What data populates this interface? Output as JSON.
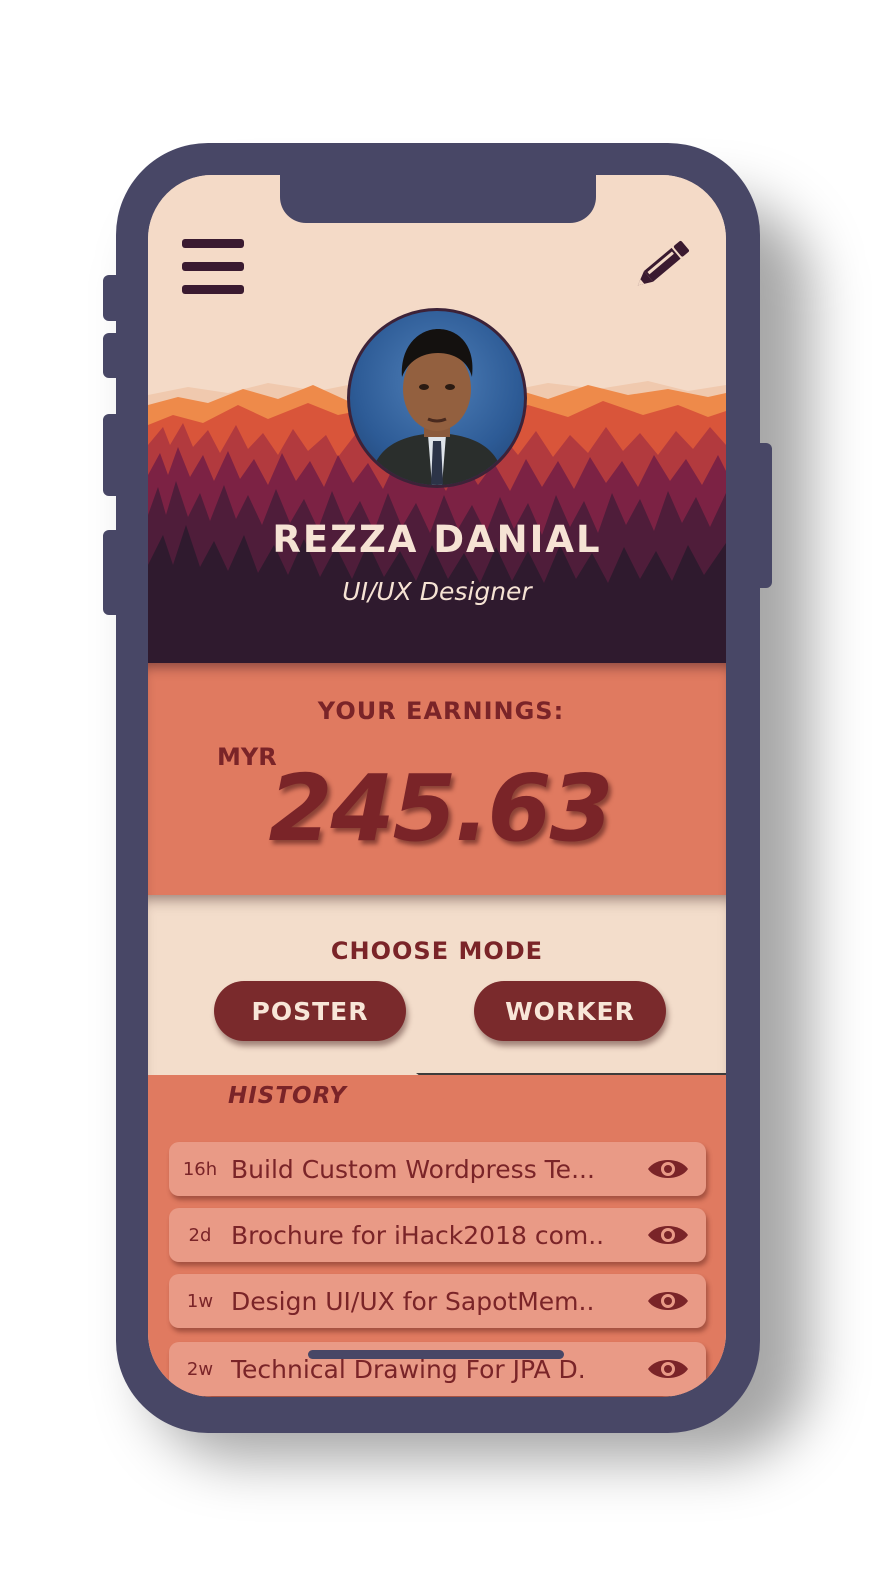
{
  "profile": {
    "name": "REZZA DANIAL",
    "role": "UI/UX Designer"
  },
  "earnings": {
    "label": "YOUR EARNINGS:",
    "currency": "MYR",
    "amount": "245.63"
  },
  "mode": {
    "title": "CHOOSE MODE",
    "poster_label": "POSTER",
    "worker_label": "WORKER"
  },
  "history": {
    "title": "HISTORY",
    "items": [
      {
        "time": "16h",
        "title": "Build Custom Wordpress Te..."
      },
      {
        "time": "2d",
        "title": "Brochure for iHack2018 com.."
      },
      {
        "time": "1w",
        "title": "Design UI/UX for SapotMem.."
      },
      {
        "time": "2w",
        "title": "Technical Drawing For JPA D."
      }
    ]
  },
  "icons": {
    "menu": "menu-icon",
    "edit": "pencil-icon",
    "view": "eye-icon"
  },
  "colors": {
    "frame": "#484766",
    "header_bg": "#f4dac7",
    "dark_band": "#2f1a2e",
    "earnings_bg": "#e07a60",
    "accent_text": "#7a2428",
    "button_bg": "#7a2a2c",
    "history_item_bg": "#e99a86"
  }
}
